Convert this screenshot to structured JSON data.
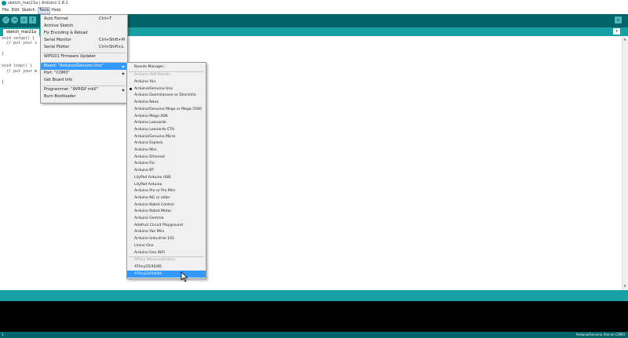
{
  "window": {
    "title": "sketch_mar21a | Arduino 1.8.1"
  },
  "menubar": {
    "items": [
      "File",
      "Edit",
      "Sketch",
      "Tools",
      "Help"
    ]
  },
  "tab": {
    "name": "sketch_mar21a",
    "menu_glyph": "▾"
  },
  "serial_monitor_glyph": "⌕",
  "code": {
    "lines": [
      "void setup() {",
      "  // put your s",
      "",
      "}",
      "",
      "void loop() {",
      "  // put your m",
      "",
      "}"
    ]
  },
  "tools_menu": {
    "auto_format": "Auto Format",
    "auto_format_shortcut": "Ctrl+T",
    "archive_sketch": "Archive Sketch",
    "fix_encoding": "Fix Encoding & Reload",
    "serial_monitor": "Serial Monitor",
    "serial_monitor_shortcut": "Ctrl+Shift+M",
    "serial_plotter": "Serial Plotter",
    "serial_plotter_shortcut": "Ctrl+Shift+L",
    "wifi_updater": "WiFi101 Firmware Updater",
    "board": "Board: \"Arduino/Genuino Uno\"",
    "port": "Port: \"COM3\"",
    "get_board_info": "Get Board Info",
    "programmer": "Programmer: \"AVRISP mkII\"",
    "burn_bootloader": "Burn Bootloader"
  },
  "board_menu": {
    "boards_manager": "Boards Manager...",
    "avr_header": "Arduino AVR Boards",
    "avr_boards": [
      "Arduino Yún",
      "Arduino/Genuino Uno",
      "Arduino Duemilanove or Diecimila",
      "Arduino Nano",
      "Arduino/Genuino Mega or Mega 2560",
      "Arduino Mega ADK",
      "Arduino Leonardo",
      "Arduino Leonardo ETH",
      "Arduino/Genuino Micro",
      "Arduino Esplora",
      "Arduino Mini",
      "Arduino Ethernet",
      "Arduino Fio",
      "Arduino BT",
      "LilyPad Arduino USB",
      "LilyPad Arduino",
      "Arduino Pro or Pro Mini",
      "Arduino NG or older",
      "Arduino Robot Control",
      "Arduino Robot Motor",
      "Arduino Gemma",
      "Adafruit Circuit Playground",
      "Arduino Yún Mini",
      "Arduino Industrial 101",
      "Linino One",
      "Arduino Uno WiFi"
    ],
    "attiny_header": "ATtiny Microcontrollers",
    "attiny_boards": [
      "ATtiny25/45/85",
      "ATtiny24/44/84"
    ]
  },
  "footer": {
    "line": "1",
    "board_port": "Arduino/Genuino Uno on COM3"
  },
  "colors": {
    "toolbar": "#006468",
    "tabbar": "#17a1a5",
    "highlight": "#3399ff",
    "console": "#000000"
  }
}
